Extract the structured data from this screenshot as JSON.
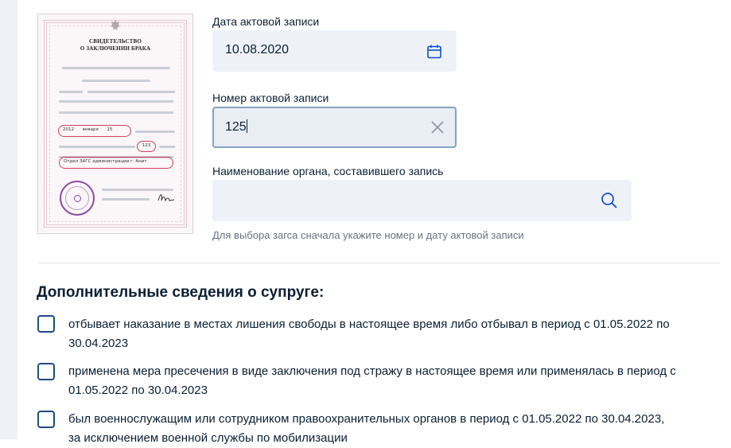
{
  "certificate": {
    "title_line1": "СВИДЕТЕЛЬСТВО",
    "title_line2": "О ЗАКЛЮЧЕНИИ БРАКА",
    "year": "2012",
    "month": "января",
    "day": "15",
    "record_number": "123",
    "registry_office": "Отдел ЗАГС администрации г. Анит"
  },
  "form": {
    "record_date": {
      "label": "Дата актовой записи",
      "value": "10.08.2020",
      "icon": "calendar-icon"
    },
    "record_number": {
      "label": "Номер актовой записи",
      "value": "125",
      "icon": "clear-x-icon"
    },
    "registry_office": {
      "label": "Наименование органа, составившего запись",
      "value": "",
      "icon": "search-icon",
      "hint": "Для выбора загса сначала укажите номер и дату актовой записи"
    }
  },
  "spouse_section": {
    "title": "Дополнительные сведения о супруге:",
    "options": [
      {
        "line1": "отбывает наказание в местах лишения свободы в настоящее время либо отбывал в период с 01.05.2022 по",
        "line2": "30.04.2023",
        "checked": false
      },
      {
        "line1": "применена мера пресечения в виде заключения под стражу в настоящее время или применялась в период с",
        "line2": "01.05.2022 по 30.04.2023",
        "checked": false
      },
      {
        "line1": "был военнослужащим или сотрудником правоохранительных органов в период с 01.05.2022 по 30.04.2023,",
        "line2": "за исключением военной службы по мобилизации",
        "checked": false
      }
    ]
  },
  "colors": {
    "field_bg": "#eef2f8",
    "focus_border": "#86a1c2",
    "checkbox_border": "#1d4c86",
    "icon": "#0d4cd3"
  }
}
